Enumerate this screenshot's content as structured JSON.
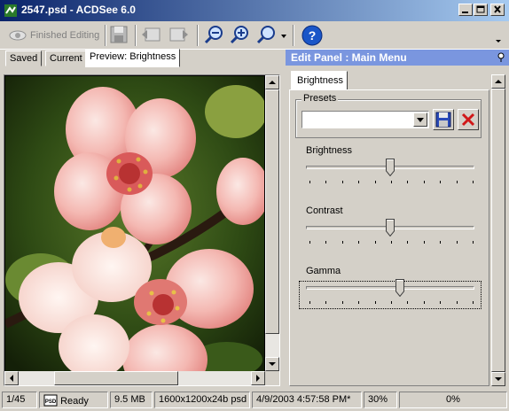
{
  "window": {
    "title": "2547.psd - ACDSee 6.0"
  },
  "toolbar": {
    "finished_editing_label": "Finished Editing"
  },
  "tabs": [
    {
      "label": "Saved"
    },
    {
      "label": "Current"
    },
    {
      "label": "Preview: Brightness"
    }
  ],
  "panel": {
    "title": "Edit Panel : Main Menu",
    "tab_label": "Brightness",
    "presets_label": "Presets",
    "preset_value": "",
    "sliders": [
      {
        "label": "Brightness",
        "level_pct": 50
      },
      {
        "label": "Contrast",
        "level_pct": 50
      },
      {
        "label": "Gamma",
        "level_pct": 56
      }
    ]
  },
  "status": {
    "position": "1/45",
    "state": "Ready",
    "file_size": "9.5 MB",
    "dimensions": "1600x1200x24b psd",
    "date": "4/9/2003 4:57:58 PM*",
    "zoom": "30%",
    "progress": "0%"
  },
  "colors": {
    "title_bar": "#0a246a",
    "panel_header": "#7a96df",
    "flower_pink": "#f0a8a4"
  }
}
